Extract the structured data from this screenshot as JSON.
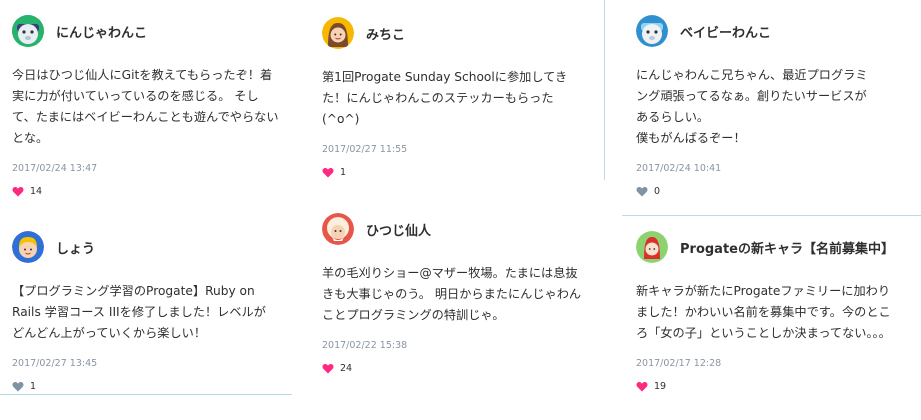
{
  "posts": [
    {
      "user": "にんじゃわんこ",
      "avatar": "ninja-dog-avatar",
      "text": "今日はひつじ仙人にGitを教えてもらったぞ！着実に力が付いていっているのを感じる。 そして、たまにはベイビーわんことも遊んでやらないとな。",
      "time": "2017/02/24 13:47",
      "likes": "14",
      "liked": true
    },
    {
      "user": "みちこ",
      "avatar": "girl-avatar",
      "text": "第1回Progate Sunday Schoolに参加してきた！にんじゃわんこのステッカーもらった(^o^)",
      "time": "2017/02/27 11:55",
      "likes": "1",
      "liked": true
    },
    {
      "user": "ベイビーわんこ",
      "avatar": "baby-dog-avatar",
      "text": "にんじゃわんこ兄ちゃん、最近プログラミング頑張ってるなぁ。創りたいサービスがあるらしい。\n僕もがんばるぞー！",
      "time": "2017/02/24 10:41",
      "likes": "0",
      "liked": false
    },
    {
      "user": "しょう",
      "avatar": "boy-avatar",
      "text": "【プログラミング学習のProgate】Ruby on Rails 学習コース IIIを修了しました！レベルがどんどん上がっていくから楽しい！",
      "time": "2017/02/27 13:45",
      "likes": "1",
      "liked": false
    },
    {
      "user": "ひつじ仙人",
      "avatar": "sheep-sage-avatar",
      "text": "羊の毛刈りショー@マザー牧場。たまには息抜きも大事じゃのう。 明日からまたにんじゃわんことプログラミングの特訓じゃ。",
      "time": "2017/02/22 15:38",
      "likes": "24",
      "liked": true
    },
    {
      "user": "Progateの新キャラ【名前募集中】",
      "avatar": "new-character-avatar",
      "text": "新キャラが新たにProgateファミリーに加わりました！かわいい名前を募集中です。今のところ「女の子」ということしか決まってない。。。",
      "time": "2017/02/17 12:28",
      "likes": "19",
      "liked": true
    }
  ],
  "colors": {
    "heart_liked": "#ff2a7f",
    "heart_unliked": "#7f93a5",
    "divider": "#b9dbe8",
    "timestamp": "#8a95a3"
  }
}
